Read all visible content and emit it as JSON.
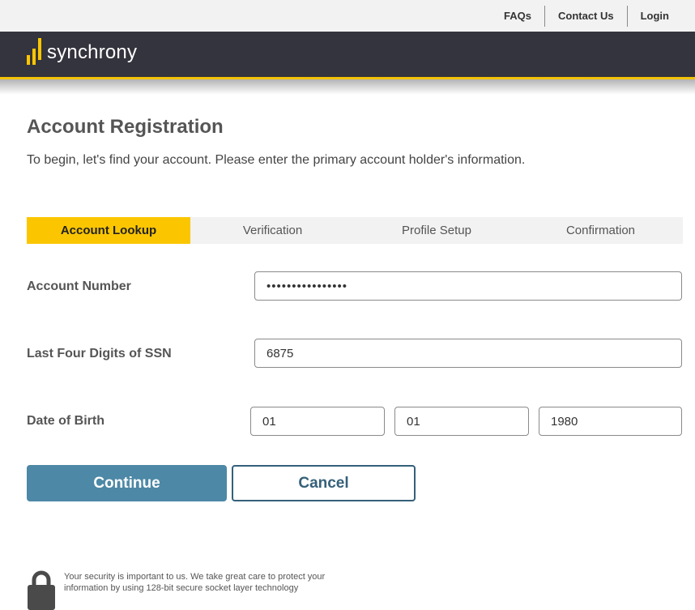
{
  "header": {
    "links": [
      "FAQs",
      "Contact Us",
      "Login"
    ],
    "brand_name": "synchrony",
    "brand_color": "#fbc600",
    "bar_color": "#34343e"
  },
  "page": {
    "title": "Account Registration",
    "intro": "To begin, let's find your account. Please enter the primary account holder's information."
  },
  "steps": {
    "items": [
      "Account Lookup",
      "Verification",
      "Profile Setup",
      "Confirmation"
    ],
    "active": "Account Lookup"
  },
  "form": {
    "account_number_label": "Account Number",
    "account_number_value": "••••••••••••••••",
    "ssn_label": "Last Four Digits of SSN",
    "ssn_value": "6875",
    "dob_label": "Date of Birth",
    "dob_month": "01",
    "dob_day": "01",
    "dob_year": "1980"
  },
  "actions": {
    "continue_label": "Continue",
    "cancel_label": "Cancel",
    "continue_color": "#4d88a6"
  },
  "footer": {
    "security_text": "Your security is important to us. We take great care to protect your information by using 128-bit secure socket layer technology",
    "lock_icon": "lock-icon"
  }
}
